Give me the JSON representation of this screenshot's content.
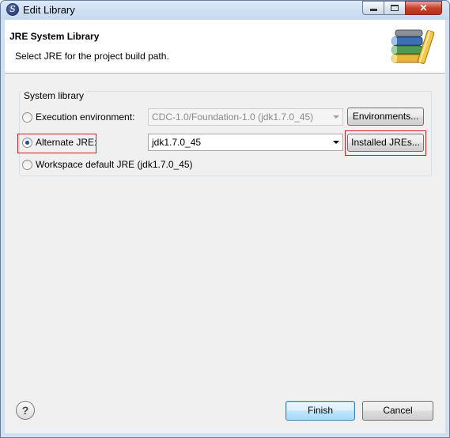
{
  "window": {
    "title": "Edit Library",
    "app_icon_letter": "S",
    "close_glyph": "✕"
  },
  "header": {
    "title": "JRE System Library",
    "subtitle": "Select JRE for the project build path.",
    "icon": "library-books-icon"
  },
  "group": {
    "label": "System library",
    "options": [
      {
        "label": "Execution environment:",
        "selected": false,
        "combo_value": "CDC-1.0/Foundation-1.0 (jdk1.7.0_45)",
        "combo_enabled": false,
        "button": "Environments..."
      },
      {
        "label": "Alternate JRE:",
        "selected": true,
        "combo_value": "jdk1.7.0_45",
        "combo_enabled": true,
        "button": "Installed JREs..."
      },
      {
        "label": "Workspace default JRE (jdk1.7.0_45)",
        "selected": false
      }
    ]
  },
  "footer": {
    "help_glyph": "?",
    "finish_label": "Finish",
    "cancel_label": "Cancel"
  },
  "colors": {
    "highlight": "#d11a1a",
    "title_bar": "#c4d8ee",
    "close_button": "#c7432a",
    "default_button_border": "#3c7fb1"
  }
}
